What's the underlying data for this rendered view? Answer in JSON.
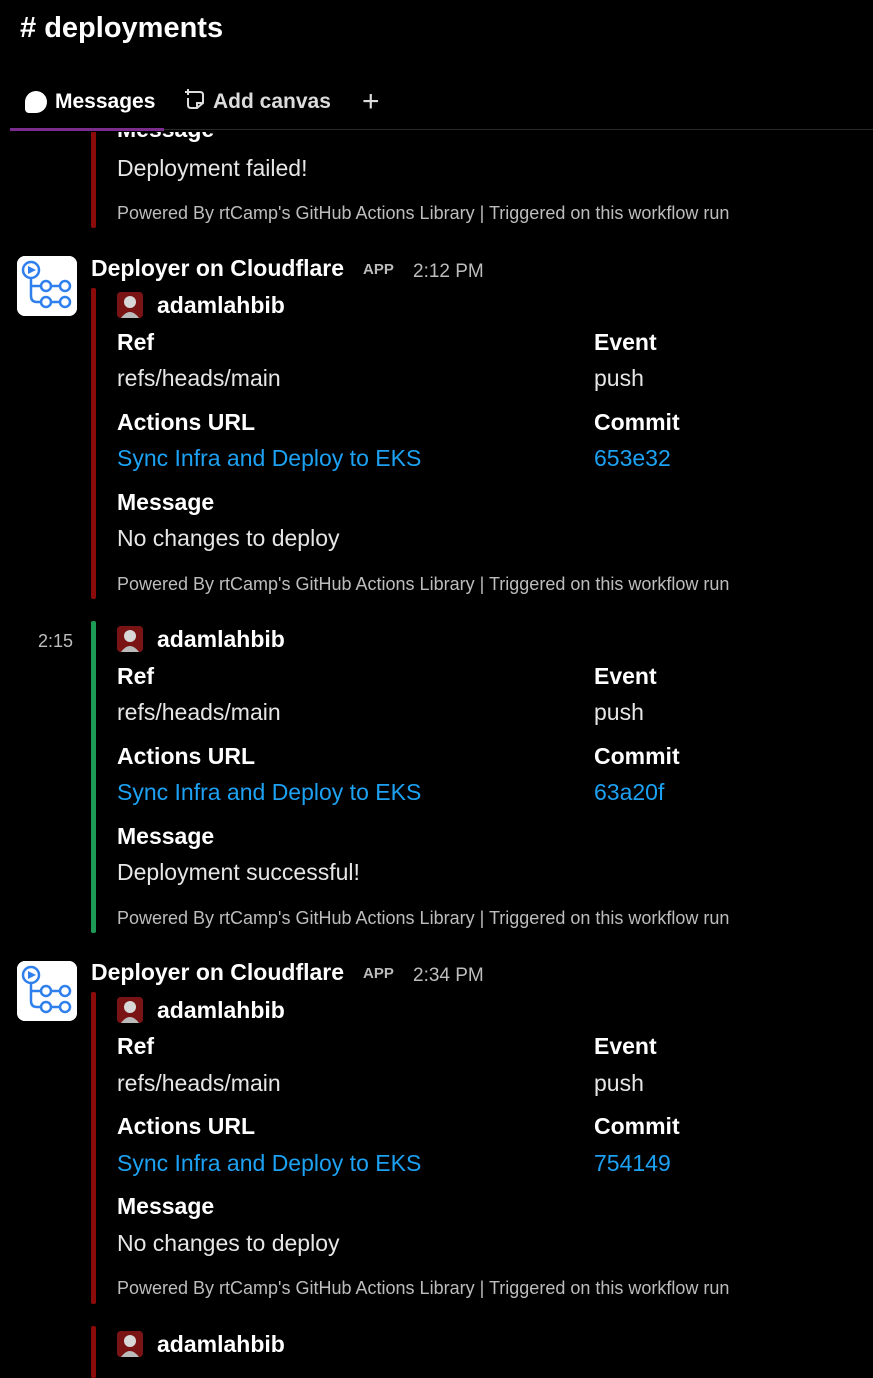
{
  "channel": {
    "hash": "#",
    "name": "deployments"
  },
  "tabs": {
    "messages": "Messages",
    "add_canvas": "Add canvas",
    "plus": "+"
  },
  "colors": {
    "failed": "#8b0a0a",
    "success": "#1e9a57",
    "link": "#1da1f2"
  },
  "top_partial": {
    "message_label": "Message",
    "message_value": "Deployment failed!",
    "footer_powered": "Powered By rtCamp's GitHub Actions Library",
    "footer_sep": "|",
    "footer_triggered": "Triggered on this workflow run"
  },
  "messages": [
    {
      "sender": "Deployer on Cloudflare",
      "badge": "APP",
      "time": "2:12 PM",
      "author": "adamlahbib",
      "ref_label": "Ref",
      "ref_value": "refs/heads/main",
      "event_label": "Event",
      "event_value": "push",
      "actions_label": "Actions URL",
      "actions_value": "Sync Infra and Deploy to EKS",
      "commit_label": "Commit",
      "commit_value": "653e32",
      "message_label": "Message",
      "message_value": "No changes to deploy",
      "footer_powered": "Powered By rtCamp's GitHub Actions Library",
      "footer_sep": "|",
      "footer_triggered": "Triggered on this workflow run"
    },
    {
      "side_time": "2:15",
      "author": "adamlahbib",
      "ref_label": "Ref",
      "ref_value": "refs/heads/main",
      "event_label": "Event",
      "event_value": "push",
      "actions_label": "Actions URL",
      "actions_value": "Sync Infra and Deploy to EKS",
      "commit_label": "Commit",
      "commit_value": "63a20f",
      "message_label": "Message",
      "message_value": "Deployment successful!",
      "footer_powered": "Powered By rtCamp's GitHub Actions Library",
      "footer_sep": "|",
      "footer_triggered": "Triggered on this workflow run"
    },
    {
      "sender": "Deployer on Cloudflare",
      "badge": "APP",
      "time": "2:34 PM",
      "author": "adamlahbib",
      "ref_label": "Ref",
      "ref_value": "refs/heads/main",
      "event_label": "Event",
      "event_value": "push",
      "actions_label": "Actions URL",
      "actions_value": "Sync Infra and Deploy to EKS",
      "commit_label": "Commit",
      "commit_value": "754149",
      "message_label": "Message",
      "message_value": "No changes to deploy",
      "footer_powered": "Powered By rtCamp's GitHub Actions Library",
      "footer_sep": "|",
      "footer_triggered": "Triggered on this workflow run"
    },
    {
      "author": "adamlahbib"
    }
  ]
}
